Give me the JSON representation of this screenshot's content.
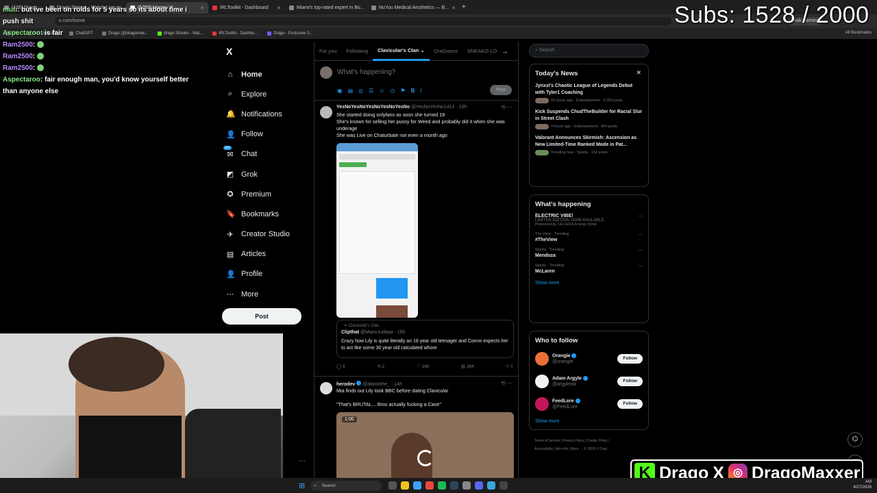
{
  "browser": {
    "tabs": [
      {
        "label": "(176) Drago..."
      },
      {
        "label": "Drago Stream - Watch Live on..."
      },
      {
        "label": "(1259) Home / X",
        "active": true
      },
      {
        "label": "IRLToolkit - Dashboard"
      },
      {
        "label": "Miami's top-rated expert in Bo..."
      },
      {
        "label": "NuYou Medical Aesthetics — B..."
      }
    ],
    "url": "x.com/home",
    "ask_gemini": "Ask Gemini",
    "bookmarks": [
      "edu",
      "work/personal",
      "ChatGPT",
      "Drago (@dragomax...",
      "drago Stream - Wat...",
      "IRLToolkit - Dashbo...",
      "Drago - Exclusive S..."
    ],
    "all_bookmarks": "All Bookmarks"
  },
  "overlay": {
    "subs": "Subs: 1528 / 2000",
    "chat": [
      {
        "name": "muti",
        "color": "green",
        "text": "but ive been on roids for 5 years so its about time i push shit"
      },
      {
        "name": "Aspectaroo",
        "color": "green",
        "text": "is fair"
      },
      {
        "name": "Ram2500",
        "color": "purple",
        "text": ""
      },
      {
        "name": "Ram2500",
        "color": "purple",
        "text": ""
      },
      {
        "name": "Ram2500",
        "color": "purple",
        "text": ""
      },
      {
        "name": "Aspectaroo",
        "color": "green",
        "text": "fair enough man, you'd know yourself better than anyone else"
      }
    ],
    "brand": {
      "name1": "Drago",
      "x": "X",
      "name2": "DragoMaxxer"
    }
  },
  "nav": {
    "logo": "X",
    "items": [
      {
        "label": "Home",
        "icon": "home-icon",
        "glyph": "⌂",
        "active": true
      },
      {
        "label": "Explore",
        "icon": "search-icon",
        "glyph": "⌕"
      },
      {
        "label": "Notifications",
        "icon": "bell-icon",
        "glyph": "🔔"
      },
      {
        "label": "Follow",
        "icon": "follow-icon",
        "glyph": "👤"
      },
      {
        "label": "Chat",
        "icon": "chat-icon",
        "glyph": "✉"
      },
      {
        "label": "Grok",
        "icon": "grok-icon",
        "glyph": "◩"
      },
      {
        "label": "Premium",
        "icon": "premium-icon",
        "glyph": "✪"
      },
      {
        "label": "Bookmarks",
        "icon": "bookmark-icon",
        "glyph": "🔖"
      },
      {
        "label": "Creator Studio",
        "icon": "rocket-icon",
        "glyph": "✈"
      },
      {
        "label": "Articles",
        "icon": "articles-icon",
        "glyph": "▤"
      },
      {
        "label": "Profile",
        "icon": "profile-icon",
        "glyph": "👤"
      },
      {
        "label": "More",
        "icon": "more-icon",
        "glyph": "⋯"
      }
    ],
    "chat_badge": "20+",
    "post": "Post"
  },
  "feed": {
    "tabs": [
      "For you",
      "Following",
      "Clavicular's Clan",
      "DraGoons",
      "SNEAKO LO"
    ],
    "compose_placeholder": "What's happening?",
    "compose_post": "Post",
    "tweet1": {
      "name": "YesNoYesNoYesNoYesNoYesNo",
      "handle": "@YesNoYesNo1414 · 16h",
      "lines": [
        "She started doing onlyfans as soon she turned 18",
        "She's known for selling her pussy for Weed and probably did it when she was underage",
        "She was Live on Chaturbate not even a month ago"
      ],
      "quote_community": "Clavicular's Clan",
      "quote_name": "Clipthat",
      "quote_handle": "@MarioJudaaa · 16h",
      "quote_text": "Crazy how Lily is quite literally an 18 year old teenager and Comm expects her to act like some 30 year old calculated whore",
      "stats": {
        "replies": "6",
        "reposts": "2",
        "likes": "166",
        "views": "36K"
      }
    },
    "tweet2": {
      "name": "herodev",
      "handle": "@alantothe_ · 14h",
      "line1": "Mia finds out Lily took BBC before dating Clavicular",
      "line2": "\"That's BRUTAL... Bros actually fucking a Cave\"",
      "video_time": "1:00"
    }
  },
  "right": {
    "search_placeholder": "Search",
    "todays_news": {
      "title": "Today's News",
      "items": [
        {
          "title": "Jynxzi's Chaotic League of Legends Debut with Tyler1 Coaching",
          "meta": "15 hours ago · Entertainment · 4,259 posts"
        },
        {
          "title": "Kick Suspends ChudTheBuilder for Racial Slur in Street Clash",
          "meta": "4 hours ago · Entertainment · 464 posts"
        },
        {
          "title": "Valorant Announces Skirmish: Ascension as New Limited-Time Ranked Mode in Pat...",
          "meta": "Trending now · Sports · 154 posts"
        }
      ]
    },
    "whats_happening": {
      "title": "What's happening",
      "items": [
        {
          "cat": "",
          "title": "ELECTRIC VIBE!",
          "desc": "LIMITED EDITION. NOW AVAILABLE.",
          "promo": "Promoted by CELSIUS Energy Drink"
        },
        {
          "cat": "The View · Trending",
          "title": "#TheView"
        },
        {
          "cat": "Sports · Trending",
          "title": "Mendoza"
        },
        {
          "cat": "Sports · Trending",
          "title": "McLaren"
        }
      ],
      "show_more": "Show more"
    },
    "who_to_follow": {
      "title": "Who to follow",
      "items": [
        {
          "name": "Orangie",
          "handle": "@orangie",
          "color": "#e8713a"
        },
        {
          "name": "Adam Argyle",
          "handle": "@argyleink",
          "color": "#f2f2f2"
        },
        {
          "name": "FeedLore",
          "handle": "@FeedLore",
          "color": "#c2185b"
        }
      ],
      "follow": "Follow",
      "show_more": "Show more"
    },
    "footer": [
      "Terms of Service",
      "Privacy Policy",
      "Cookie Policy",
      "Accessibility",
      "Ads info",
      "More ···",
      "© 2026 X Corp."
    ]
  },
  "taskbar": {
    "search": "Search",
    "time": "AM",
    "date": "4/27/2026"
  }
}
